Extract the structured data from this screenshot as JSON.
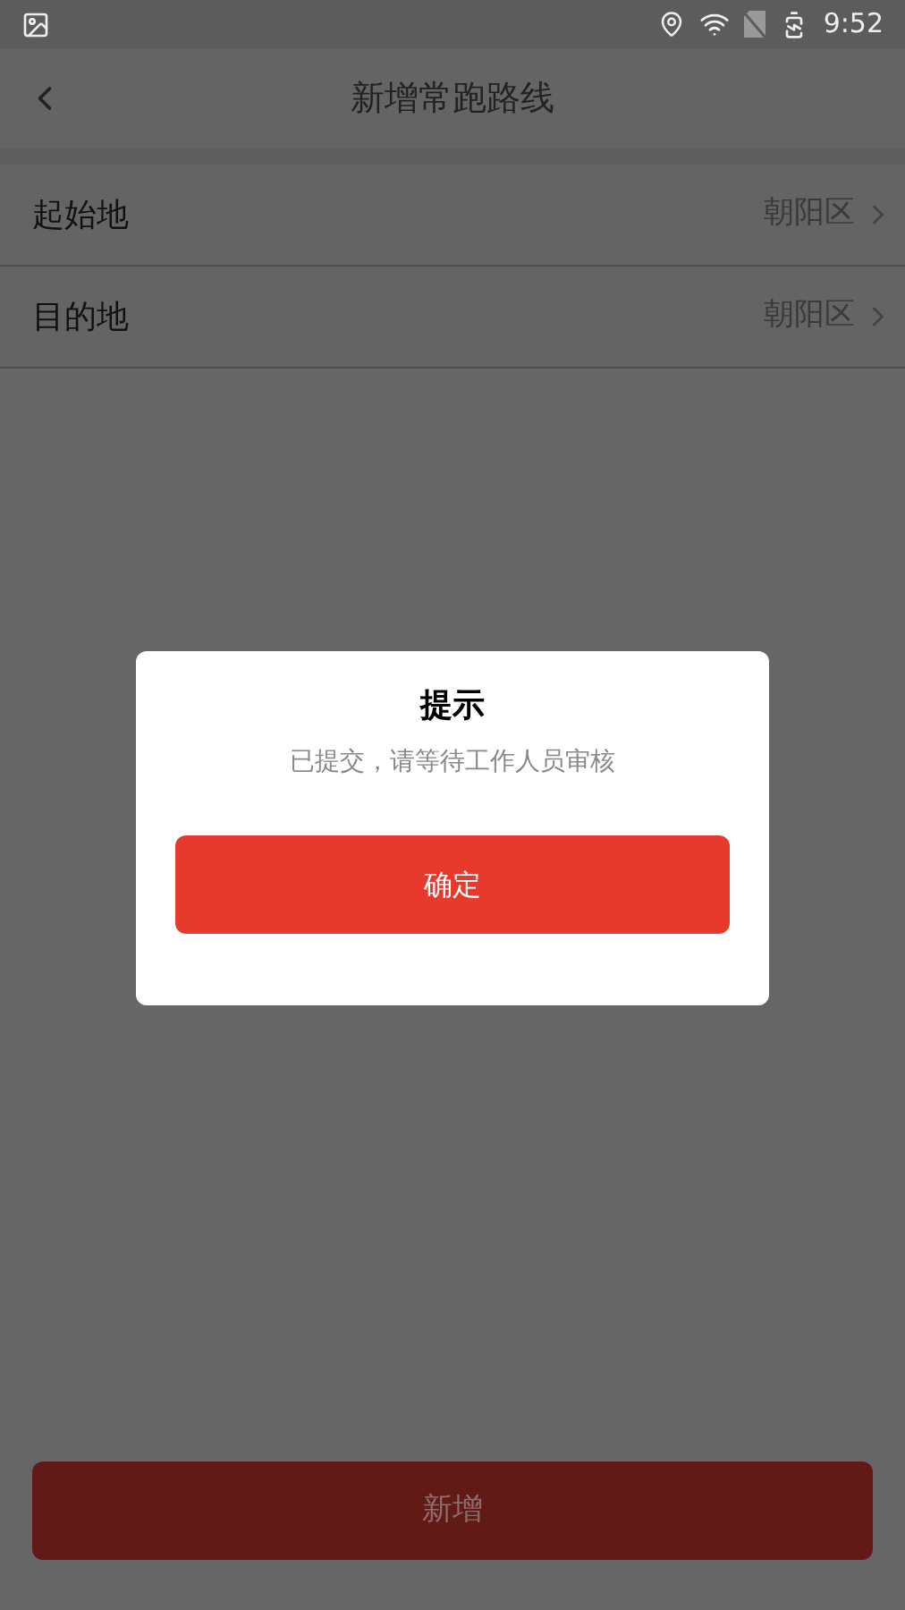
{
  "status_bar": {
    "time": "9:52"
  },
  "header": {
    "title": "新增常跑路线"
  },
  "rows": [
    {
      "label": "起始地",
      "value": "朝阳区"
    },
    {
      "label": "目的地",
      "value": "朝阳区"
    }
  ],
  "dialog": {
    "title": "提示",
    "message": "已提交，请等待工作人员审核",
    "button": "确定"
  },
  "bottom_button": {
    "label": "新增"
  }
}
